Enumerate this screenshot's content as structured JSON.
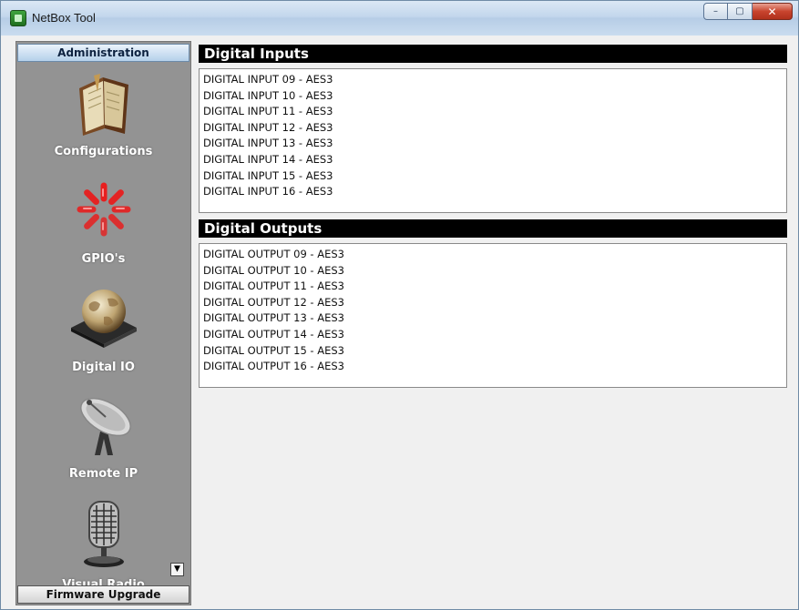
{
  "window": {
    "title": "NetBox Tool",
    "buttons": {
      "minimize": "–",
      "maximize": "▢",
      "close": "✕"
    }
  },
  "sidebar": {
    "header": "Administration",
    "footer": "Firmware Upgrade",
    "scroll_button": "▼",
    "items": [
      {
        "label": "Configurations",
        "icon": "book-icon"
      },
      {
        "label": "GPIO's",
        "icon": "spinner-icon"
      },
      {
        "label": "Digital IO",
        "icon": "globe-icon"
      },
      {
        "label": "Remote IP",
        "icon": "satellite-dish-icon"
      },
      {
        "label": "Visual Radio",
        "icon": "microphone-icon"
      }
    ]
  },
  "digital_inputs": {
    "title": "Digital Inputs",
    "rows": [
      "DIGITAL INPUT 09 - AES3",
      "DIGITAL INPUT 10 - AES3",
      "DIGITAL INPUT 11 - AES3",
      "DIGITAL INPUT 12 - AES3",
      "DIGITAL INPUT 13 - AES3",
      "DIGITAL INPUT 14 - AES3",
      "DIGITAL INPUT 15 - AES3",
      "DIGITAL INPUT 16 - AES3"
    ]
  },
  "digital_outputs": {
    "title": "Digital Outputs",
    "rows": [
      "DIGITAL OUTPUT 09 - AES3",
      "DIGITAL OUTPUT 10 - AES3",
      "DIGITAL OUTPUT 11 - AES3",
      "DIGITAL OUTPUT 12 - AES3",
      "DIGITAL OUTPUT 13 - AES3",
      "DIGITAL OUTPUT 14 - AES3",
      "DIGITAL OUTPUT 15 - AES3",
      "DIGITAL OUTPUT 16 - AES3"
    ]
  },
  "colors": {
    "sidebar_bg": "#939393",
    "panel_title_bg": "#000000",
    "spinner_red": "#e81e1e"
  }
}
